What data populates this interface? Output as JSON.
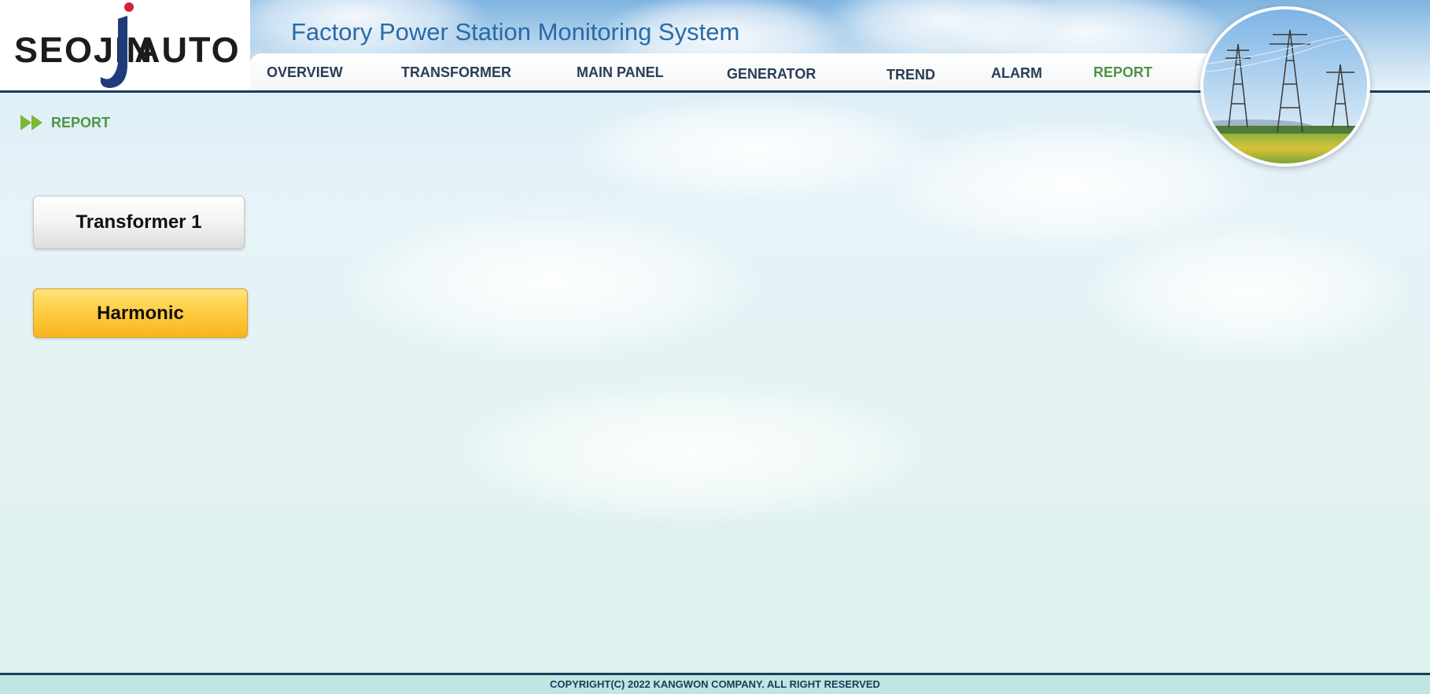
{
  "logo": {
    "left_text": "SEOJIN",
    "right_text": "AUTO"
  },
  "app_title": "Factory Power Station Monitoring System",
  "nav": {
    "items": [
      {
        "label": "OVERVIEW",
        "active": false
      },
      {
        "label": "TRANSFORMER",
        "active": false
      },
      {
        "label": "MAIN PANEL",
        "active": false
      },
      {
        "label": "GENERATOR",
        "active": false
      },
      {
        "label": "TREND",
        "active": false
      },
      {
        "label": "ALARM",
        "active": false
      },
      {
        "label": "REPORT",
        "active": true
      }
    ]
  },
  "breadcrumb": {
    "icon": "double-chevron-right-icon",
    "label": "REPORT"
  },
  "buttons": {
    "transformer": "Transformer 1",
    "harmonic": "Harmonic"
  },
  "footer": {
    "copyright": "COPYRIGHT(C) 2022 KANGWON COMPANY. ALL RIGHT RESERVED"
  },
  "colors": {
    "accent_green": "#4f9444",
    "nav_text": "#2b3d54",
    "title_blue": "#2a6aa6",
    "dark_line": "#1e3a5c",
    "harmonic_yellow": "#ffce44"
  }
}
